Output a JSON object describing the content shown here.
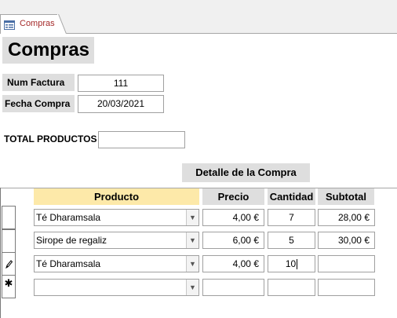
{
  "tab": {
    "label": "Compras",
    "icon": "form-icon"
  },
  "form": {
    "title": "Compras",
    "num_factura_label": "Num Factura",
    "num_factura_value": "111",
    "fecha_compra_label": "Fecha Compra",
    "fecha_compra_value": "20/03/2021",
    "total_productos_label": "TOTAL PRODUCTOS",
    "total_productos_value": ""
  },
  "subform": {
    "title": "Detalle de la Compra",
    "columns": {
      "producto": "Producto",
      "precio": "Precio",
      "cantidad": "Cantidad",
      "subtotal": "Subtotal"
    },
    "rows": [
      {
        "selector": "",
        "producto": "Té Dharamsala",
        "precio": "4,00 €",
        "cantidad": "7",
        "subtotal": "28,00 €"
      },
      {
        "selector": "",
        "producto": "Sirope de regaliz",
        "precio": "6,00 €",
        "cantidad": "5",
        "subtotal": "30,00 €"
      },
      {
        "selector": "pencil-icon",
        "producto": "Té Dharamsala",
        "precio": "4,00 €",
        "cantidad": "10",
        "subtotal": ""
      },
      {
        "selector": "new-record-icon",
        "producto": "",
        "precio": "",
        "cantidad": "",
        "subtotal": ""
      }
    ]
  }
}
